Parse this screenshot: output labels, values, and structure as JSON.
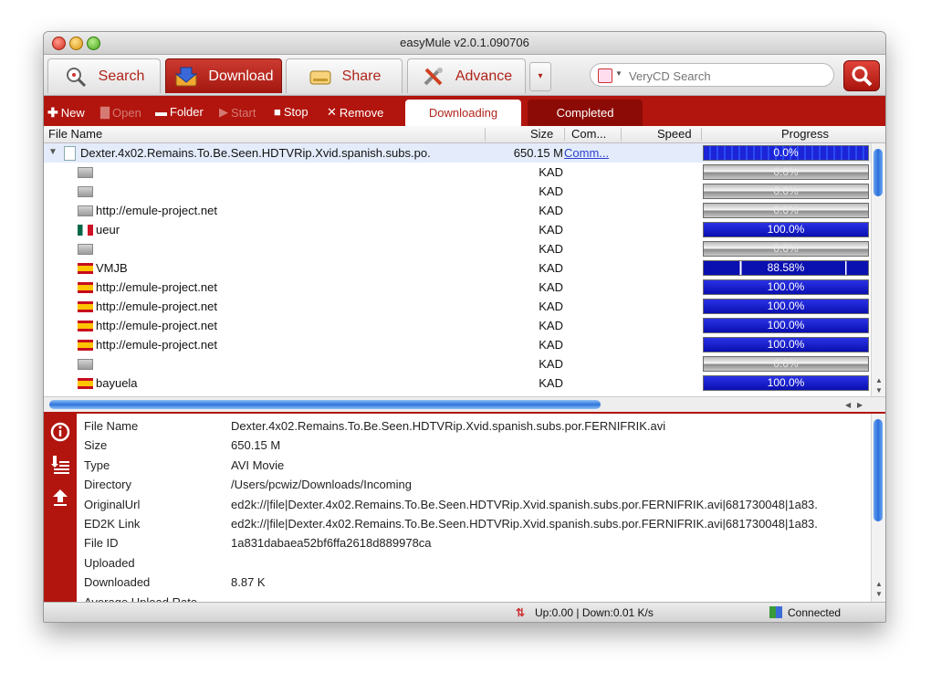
{
  "window": {
    "title": "easyMule v2.0.1.090706"
  },
  "tabs": [
    {
      "label": "Search",
      "icon": "magnifier-icon"
    },
    {
      "label": "Download",
      "icon": "download-box-icon"
    },
    {
      "label": "Share",
      "icon": "share-drive-icon"
    },
    {
      "label": "Advance",
      "icon": "tools-icon"
    }
  ],
  "search": {
    "placeholder": "VeryCD Search"
  },
  "actions": {
    "new": "New",
    "open": "Open",
    "folder": "Folder",
    "start": "Start",
    "stop": "Stop",
    "remove": "Remove"
  },
  "subtabs": {
    "downloading": "Downloading",
    "completed": "Completed"
  },
  "columns": {
    "file_name": "File Name",
    "size": "Size",
    "comment": "Com...",
    "speed": "Speed",
    "progress": "Progress"
  },
  "download": {
    "name": "Dexter.4x02.Remains.To.Be.Seen.HDTVRip.Xvid.spanish.subs.po.",
    "size": "650.15 M",
    "comment": "Comm...",
    "progress": "0.0%",
    "progress_value": 0.0
  },
  "sources": [
    {
      "flag": "blank",
      "name": "",
      "type": "KAD",
      "progress": "0.0%",
      "value": 0.0
    },
    {
      "flag": "blank",
      "name": "",
      "type": "KAD",
      "progress": "0.0%",
      "value": 0.0
    },
    {
      "flag": "blank",
      "name": "http://emule-project.net",
      "type": "KAD",
      "progress": "0.0%",
      "value": 0.0
    },
    {
      "flag": "mx",
      "name": "ueur",
      "type": "KAD",
      "progress": "100.0%",
      "value": 100.0
    },
    {
      "flag": "blank",
      "name": "",
      "type": "KAD",
      "progress": "0.0%",
      "value": 0.0
    },
    {
      "flag": "es",
      "name": "VMJB",
      "type": "KAD",
      "progress": "88.58%",
      "value": 88.58
    },
    {
      "flag": "es",
      "name": "http://emule-project.net",
      "type": "KAD",
      "progress": "100.0%",
      "value": 100.0
    },
    {
      "flag": "es",
      "name": "http://emule-project.net",
      "type": "KAD",
      "progress": "100.0%",
      "value": 100.0
    },
    {
      "flag": "es",
      "name": "http://emule-project.net",
      "type": "KAD",
      "progress": "100.0%",
      "value": 100.0
    },
    {
      "flag": "es",
      "name": "http://emule-project.net",
      "type": "KAD",
      "progress": "100.0%",
      "value": 100.0
    },
    {
      "flag": "blank",
      "name": "",
      "type": "KAD",
      "progress": "0.0%",
      "value": 0.0
    },
    {
      "flag": "es",
      "name": "bayuela",
      "type": "KAD",
      "progress": "100.0%",
      "value": 100.0
    }
  ],
  "details": [
    {
      "key": "File Name",
      "value": "Dexter.4x02.Remains.To.Be.Seen.HDTVRip.Xvid.spanish.subs.por.FERNIFRIK.avi"
    },
    {
      "key": "Size",
      "value": "650.15 M"
    },
    {
      "key": "Type",
      "value": "AVI Movie"
    },
    {
      "key": "Directory",
      "value": "/Users/pcwiz/Downloads/Incoming"
    },
    {
      "key": "OriginalUrl",
      "value": "ed2k://|file|Dexter.4x02.Remains.To.Be.Seen.HDTVRip.Xvid.spanish.subs.por.FERNIFRIK.avi|681730048|1a83."
    },
    {
      "key": "ED2K Link",
      "value": "ed2k://|file|Dexter.4x02.Remains.To.Be.Seen.HDTVRip.Xvid.spanish.subs.por.FERNIFRIK.avi|681730048|1a83."
    },
    {
      "key": "File ID",
      "value": "1a831dabaea52bf6ffa2618d889978ca"
    },
    {
      "key": "Uploaded",
      "value": ""
    },
    {
      "key": "Downloaded",
      "value": "8.87 K"
    },
    {
      "key": "Average Upload Rate",
      "value": ""
    }
  ],
  "status": {
    "transfer": "Up:0.00 | Down:0.01 K/s",
    "connection": "Connected"
  },
  "colors": {
    "brand_red": "#b1150e",
    "progress_blue": "#0a0fb0"
  }
}
